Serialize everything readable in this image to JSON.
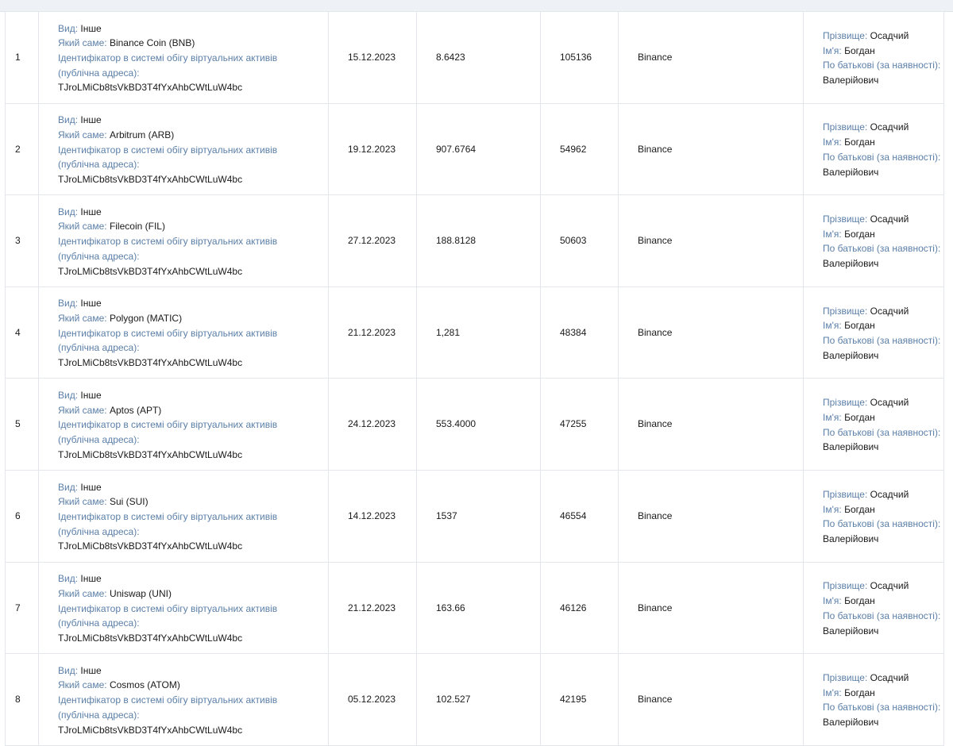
{
  "labels": {
    "kind": "Вид:",
    "which": "Який саме:",
    "identifier": "Ідентифікатор в системі обігу віртуальних активів",
    "identifier_cont": "(публічна адреса):",
    "surname": "Прізвище:",
    "name": "Ім'я:",
    "patronymic": "По батькові (за наявності):"
  },
  "rows": [
    {
      "num": "1",
      "kind": "Інше",
      "asset": "Binance Coin (BNB)",
      "address": "TJroLMiCb8tsVkBD3T4fYxAhbCWtLuW4bc",
      "date": "15.12.2023",
      "amount": "8.6423",
      "value": "105136",
      "platform": "Binance",
      "surname": "Осадчий",
      "name": "Богдан",
      "patronymic": "Валерійович"
    },
    {
      "num": "2",
      "kind": "Інше",
      "asset": "Arbitrum (ARB)",
      "address": "TJroLMiCb8tsVkBD3T4fYxAhbCWtLuW4bc",
      "date": "19.12.2023",
      "amount": "907.6764",
      "value": "54962",
      "platform": "Binance",
      "surname": "Осадчий",
      "name": "Богдан",
      "patronymic": "Валерійович"
    },
    {
      "num": "3",
      "kind": "Інше",
      "asset": "Filecoin (FIL)",
      "address": "TJroLMiCb8tsVkBD3T4fYxAhbCWtLuW4bc",
      "date": "27.12.2023",
      "amount": "188.8128",
      "value": "50603",
      "platform": "Binance",
      "surname": "Осадчий",
      "name": "Богдан",
      "patronymic": "Валерійович"
    },
    {
      "num": "4",
      "kind": "Інше",
      "asset": "Polygon (MATIC)",
      "address": "TJroLMiCb8tsVkBD3T4fYxAhbCWtLuW4bc",
      "date": "21.12.2023",
      "amount": "1,281",
      "value": "48384",
      "platform": "Binance",
      "surname": "Осадчий",
      "name": "Богдан",
      "patronymic": "Валерійович"
    },
    {
      "num": "5",
      "kind": "Інше",
      "asset": "Aptos (APT)",
      "address": "TJroLMiCb8tsVkBD3T4fYxAhbCWtLuW4bc",
      "date": "24.12.2023",
      "amount": "553.4000",
      "value": "47255",
      "platform": "Binance",
      "surname": "Осадчий",
      "name": "Богдан",
      "patronymic": "Валерійович"
    },
    {
      "num": "6",
      "kind": "Інше",
      "asset": "Sui (SUI)",
      "address": "TJroLMiCb8tsVkBD3T4fYxAhbCWtLuW4bc",
      "date": "14.12.2023",
      "amount": "1537",
      "value": "46554",
      "platform": "Binance",
      "surname": "Осадчий",
      "name": "Богдан",
      "patronymic": "Валерійович"
    },
    {
      "num": "7",
      "kind": "Інше",
      "asset": "Uniswap (UNI)",
      "address": "TJroLMiCb8tsVkBD3T4fYxAhbCWtLuW4bc",
      "date": "21.12.2023",
      "amount": "163.66",
      "value": "46126",
      "platform": "Binance",
      "surname": "Осадчий",
      "name": "Богдан",
      "patronymic": "Валерійович"
    },
    {
      "num": "8",
      "kind": "Інше",
      "asset": "Cosmos (ATOM)",
      "address": "TJroLMiCb8tsVkBD3T4fYxAhbCWtLuW4bc",
      "date": "05.12.2023",
      "amount": "102.527",
      "value": "42195",
      "platform": "Binance",
      "surname": "Осадчий",
      "name": "Богдан",
      "patronymic": "Валерійович"
    }
  ],
  "colors": {
    "label": "#5b7fa8",
    "text": "#1a1a1a",
    "border": "#e3e6ea",
    "header_strip": "#eef2f7"
  }
}
